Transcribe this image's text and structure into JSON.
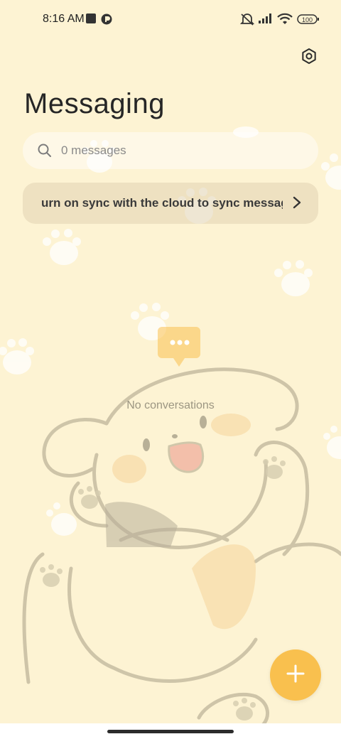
{
  "status_bar": {
    "time": "8:16 AM",
    "battery": "100",
    "icons": [
      "notification-square-icon",
      "app-badge-icon",
      "mute-icon",
      "signal-icon",
      "wifi-icon",
      "battery-icon"
    ]
  },
  "header": {
    "title": "Messaging",
    "settings_icon": "settings-gear-icon"
  },
  "search": {
    "placeholder": "0 messages",
    "icon": "search-icon"
  },
  "sync_banner": {
    "text": "urn on sync with the cloud to sync messag",
    "icon": "chevron-right-icon"
  },
  "empty_state": {
    "icon": "chat-bubble-icon",
    "text": "No conversations"
  },
  "fab": {
    "icon": "plus-icon"
  },
  "colors": {
    "background": "#fdf3d3",
    "fab": "#f9c04e",
    "chat_icon": "#f9c04e"
  }
}
